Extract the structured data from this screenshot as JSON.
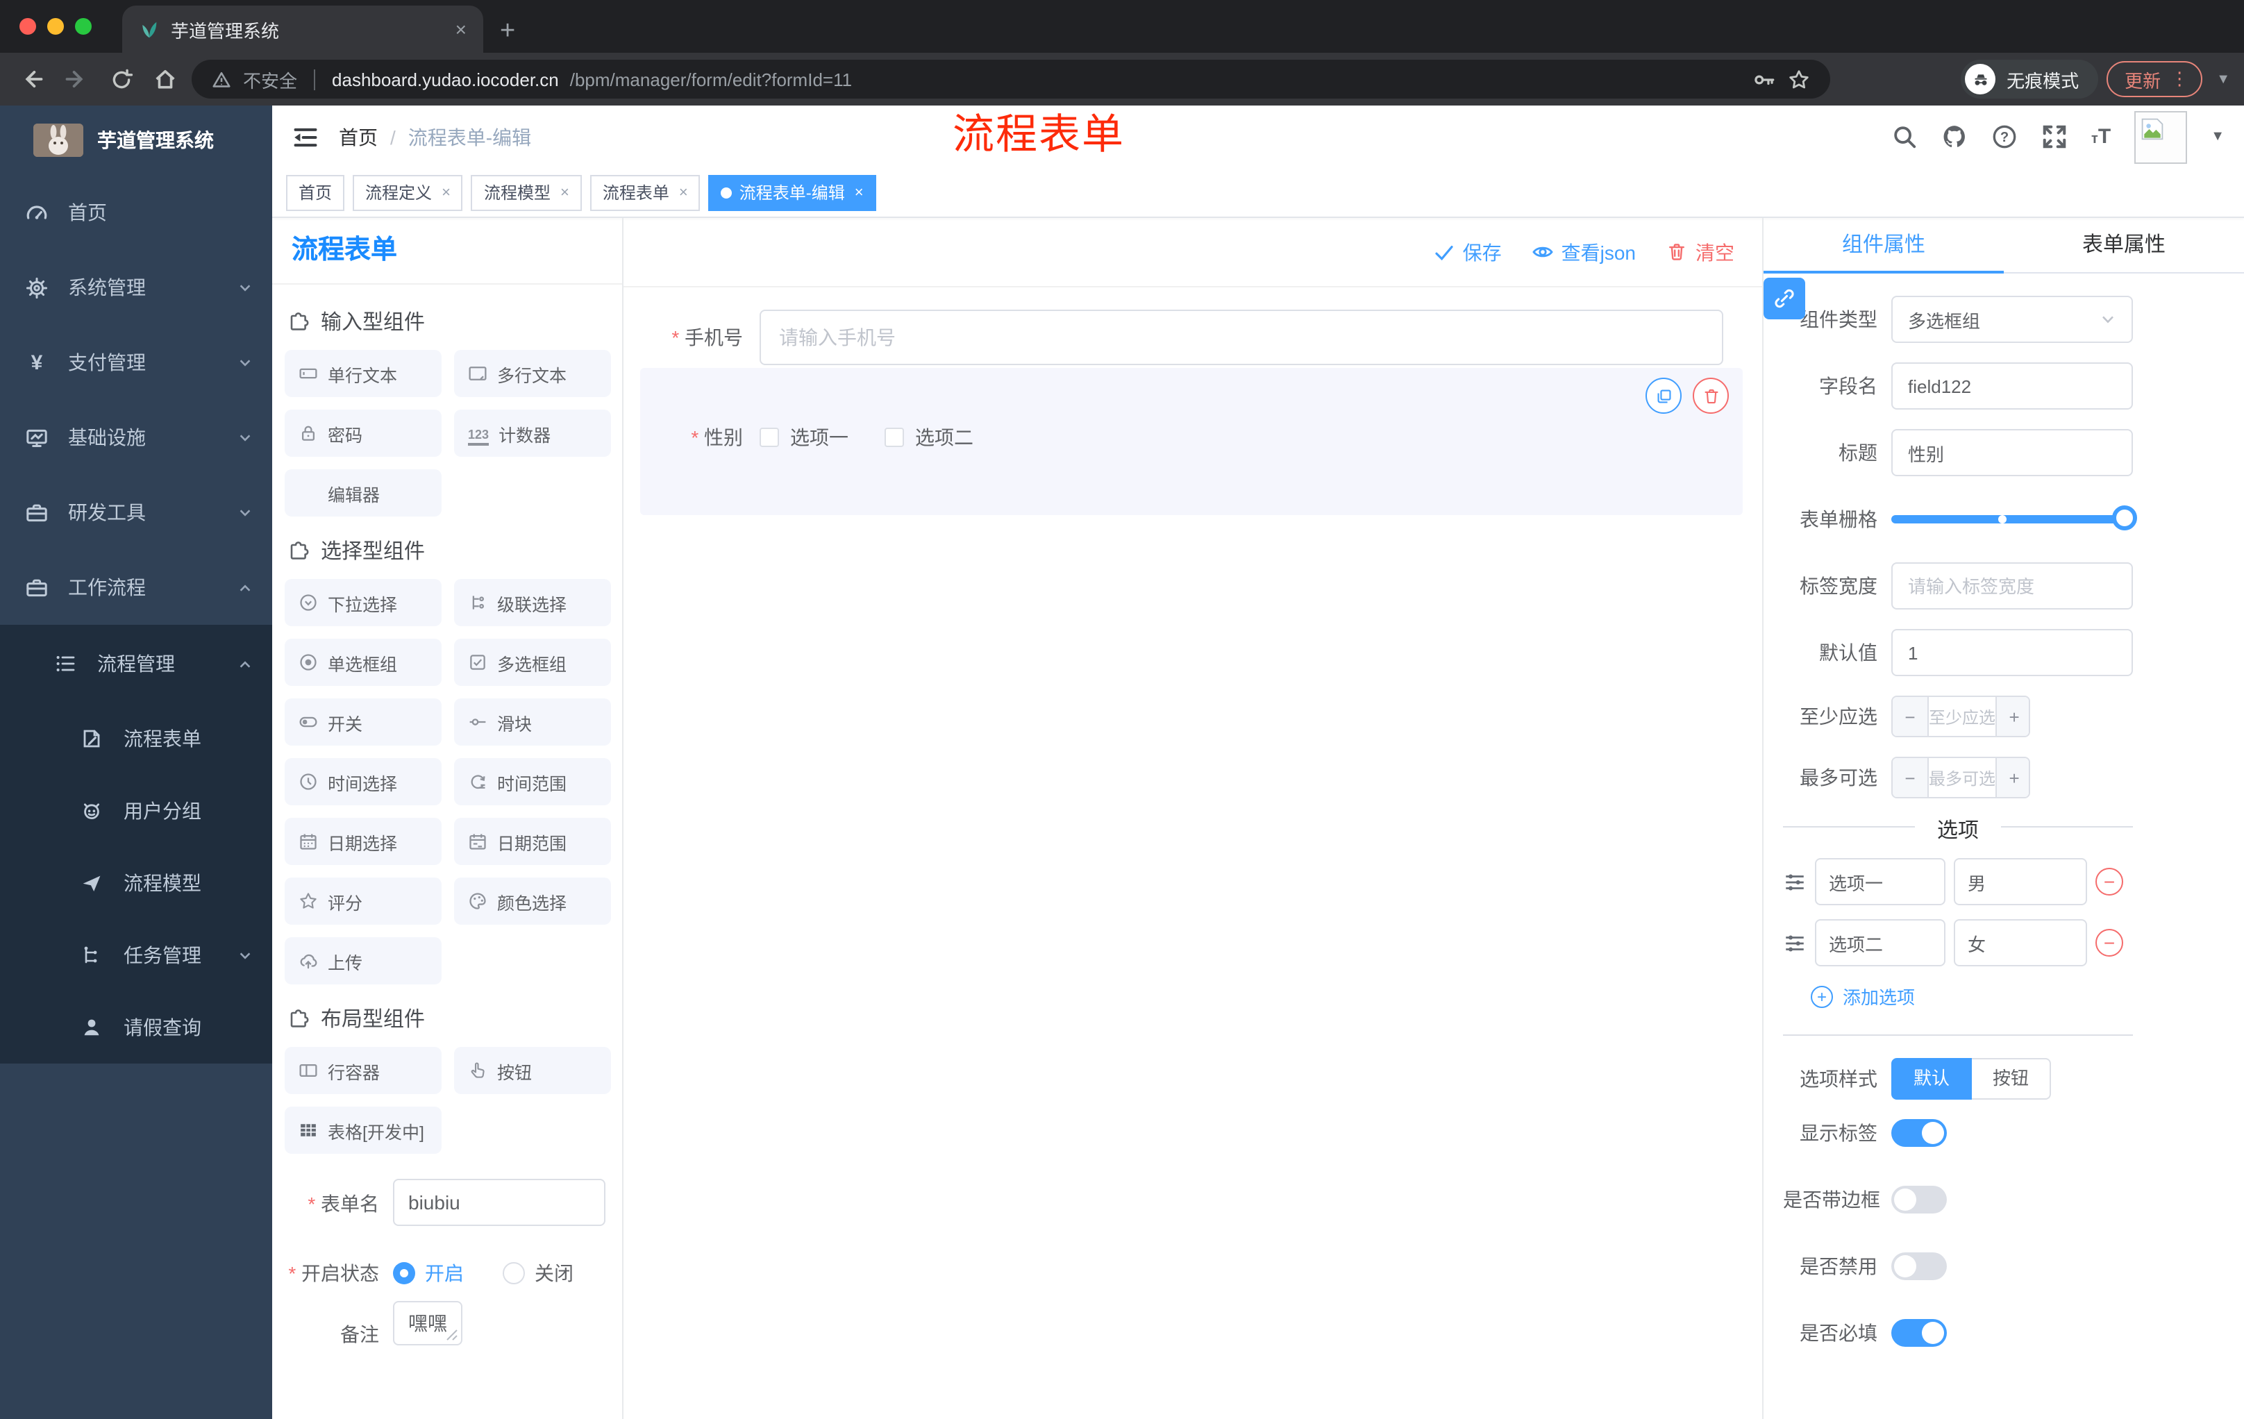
{
  "browser": {
    "tab_title": "芋道管理系统",
    "security_label": "不安全",
    "url_domain": "dashboard.yudao.iocoder.cn",
    "url_path": "/bpm/manager/form/edit?formId=11",
    "incognito_label": "无痕模式",
    "update_label": "更新"
  },
  "sidebar": {
    "logo_title": "芋道管理系统",
    "items": [
      {
        "label": "首页"
      },
      {
        "label": "系统管理"
      },
      {
        "label": "支付管理"
      },
      {
        "label": "基础设施"
      },
      {
        "label": "研发工具"
      },
      {
        "label": "工作流程"
      }
    ],
    "children": [
      {
        "label": "流程管理"
      },
      {
        "label": "流程表单"
      },
      {
        "label": "用户分组"
      },
      {
        "label": "流程模型"
      },
      {
        "label": "任务管理"
      },
      {
        "label": "请假查询"
      }
    ]
  },
  "header": {
    "breadcrumb_home": "首页",
    "breadcrumb_current": "流程表单-编辑",
    "annotation": "流程表单"
  },
  "tags": [
    {
      "label": "首页",
      "closable": false,
      "active": false
    },
    {
      "label": "流程定义",
      "closable": true,
      "active": false
    },
    {
      "label": "流程模型",
      "closable": true,
      "active": false
    },
    {
      "label": "流程表单",
      "closable": true,
      "active": false
    },
    {
      "label": "流程表单-编辑",
      "closable": true,
      "active": true
    }
  ],
  "palette": {
    "title": "流程表单",
    "sections": [
      {
        "title": "输入型组件",
        "items": [
          {
            "label": "单行文本"
          },
          {
            "label": "多行文本"
          },
          {
            "label": "密码"
          },
          {
            "label": "计数器"
          },
          {
            "label": "编辑器"
          }
        ]
      },
      {
        "title": "选择型组件",
        "items": [
          {
            "label": "下拉选择"
          },
          {
            "label": "级联选择"
          },
          {
            "label": "单选框组"
          },
          {
            "label": "多选框组"
          },
          {
            "label": "开关"
          },
          {
            "label": "滑块"
          },
          {
            "label": "时间选择"
          },
          {
            "label": "时间范围"
          },
          {
            "label": "日期选择"
          },
          {
            "label": "日期范围"
          },
          {
            "label": "评分"
          },
          {
            "label": "颜色选择"
          },
          {
            "label": "上传"
          }
        ]
      },
      {
        "title": "布局型组件",
        "items": [
          {
            "label": "行容器"
          },
          {
            "label": "按钮"
          },
          {
            "label": "表格[开发中]"
          }
        ]
      }
    ],
    "form": {
      "name_label": "表单名",
      "name_value": "biubiu",
      "status_label": "开启状态",
      "status_on": "开启",
      "status_off": "关闭",
      "status_selected": "开启",
      "remark_label": "备注",
      "remark_value": "嘿嘿"
    }
  },
  "canvas": {
    "toolbar": {
      "save": "保存",
      "view_json": "查看json",
      "clear": "清空"
    },
    "phone_field": {
      "label": "手机号",
      "placeholder": "请输入手机号"
    },
    "gender_field": {
      "label": "性别",
      "option1": "选项一",
      "option2": "选项二"
    }
  },
  "panel": {
    "tab_component": "组件属性",
    "tab_form": "表单属性",
    "active_tab": "组件属性",
    "rows": {
      "type_label": "组件类型",
      "type_value": "多选框组",
      "field_label": "字段名",
      "field_value": "field122",
      "title_label": "标题",
      "title_value": "性别",
      "grid_label": "表单栅格",
      "label_width_label": "标签宽度",
      "label_width_placeholder": "请输入标签宽度",
      "default_label": "默认值",
      "default_value": "1",
      "min_label": "至少应选",
      "min_placeholder": "至少应选",
      "max_label": "最多可选",
      "max_placeholder": "最多可选"
    },
    "options_divider": "选项",
    "options": [
      {
        "label": "选项一",
        "value": "男"
      },
      {
        "label": "选项二",
        "value": "女"
      }
    ],
    "add_option": "添加选项",
    "style_label": "选项样式",
    "style_default": "默认",
    "style_button": "按钮",
    "style_selected": "默认",
    "switches": [
      {
        "label": "显示标签",
        "on": true
      },
      {
        "label": "是否带边框",
        "on": false
      },
      {
        "label": "是否禁用",
        "on": false
      },
      {
        "label": "是否必填",
        "on": true
      }
    ]
  },
  "colors": {
    "accent": "#409eff",
    "danger": "#f56c6c",
    "annotation_red": "#fd2b0a",
    "sidebar_bg": "#304156",
    "submenu_bg": "#1f2d3d",
    "title_blue": "#1a8bff"
  }
}
